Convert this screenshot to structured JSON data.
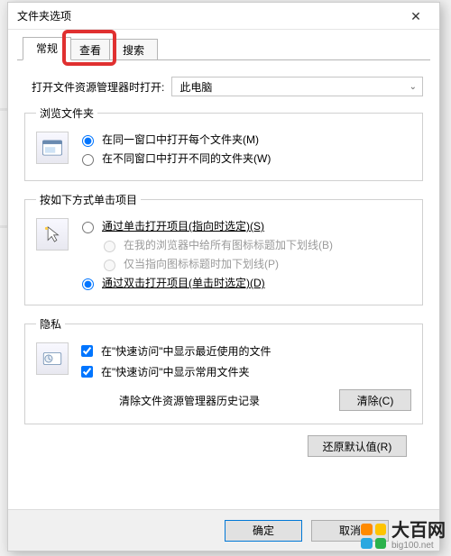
{
  "window": {
    "title": "文件夹选项",
    "close_glyph": "✕"
  },
  "tabs": {
    "general": "常规",
    "view": "查看",
    "search": "搜索"
  },
  "open_with": {
    "label": "打开文件资源管理器时打开:",
    "value": "此电脑"
  },
  "browse": {
    "legend": "浏览文件夹",
    "opt_same": "在同一窗口中打开每个文件夹(M)",
    "opt_new": "在不同窗口中打开不同的文件夹(W)"
  },
  "click": {
    "legend": "按如下方式单击项目",
    "opt_single": "通过单击打开项目(指向时选定)(S)",
    "opt_single_sub1": "在我的浏览器中给所有图标标题加下划线(B)",
    "opt_single_sub2": "仅当指向图标标题时加下划线(P)",
    "opt_double": "通过双击打开项目(单击时选定)(D)"
  },
  "privacy": {
    "legend": "隐私",
    "chk_recent": "在\"快速访问\"中显示最近使用的文件",
    "chk_frequent": "在\"快速访问\"中显示常用文件夹",
    "clear_label": "清除文件资源管理器历史记录",
    "clear_btn": "清除(C)"
  },
  "restore_btn": "还原默认值(R)",
  "buttons": {
    "ok": "确定",
    "cancel": "取消"
  },
  "watermark": {
    "text": "大百网",
    "url": "big100.net",
    "colors": [
      "#ff8a00",
      "#ffc400",
      "#2aa8e0",
      "#2bb24c"
    ]
  }
}
